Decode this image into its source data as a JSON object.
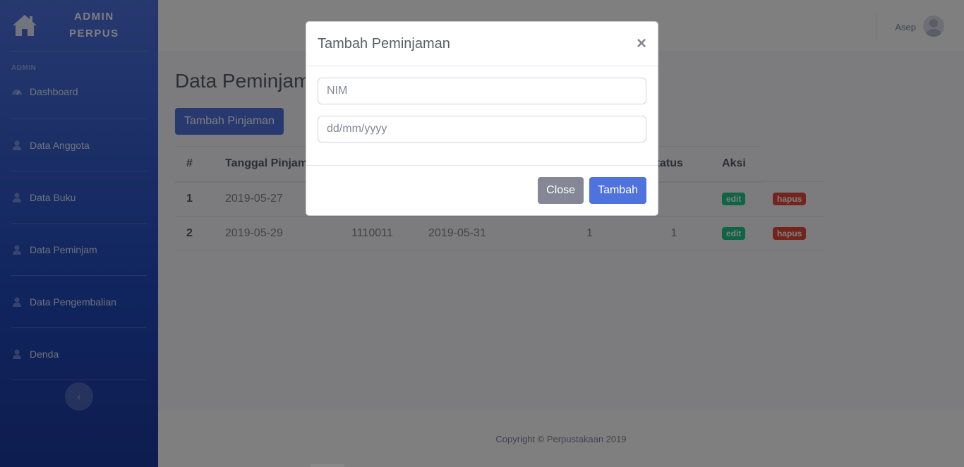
{
  "brand": {
    "line1": "ADMIN",
    "line2": "PERPUS"
  },
  "sidebar": {
    "heading": "ADMIN",
    "items": [
      {
        "label": "Dashboard",
        "icon": "tachometer-icon"
      },
      {
        "label": "Data Anggota",
        "icon": "user-icon"
      },
      {
        "label": "Data Buku",
        "icon": "user-icon"
      },
      {
        "label": "Data Peminjam",
        "icon": "user-icon"
      },
      {
        "label": "Data Pengembalian",
        "icon": "user-icon"
      },
      {
        "label": "Denda",
        "icon": "user-icon"
      }
    ],
    "toggle": "‹"
  },
  "topbar": {
    "user_name": "Asep"
  },
  "main": {
    "title": "Data Peminjaman",
    "add_button": "Tambah Pinjaman",
    "table": {
      "headers": [
        "#",
        "Tanggal Pinjam",
        "",
        "",
        "",
        "Status",
        "Aksi",
        ""
      ],
      "rows": [
        {
          "no": "1",
          "tanggal": "2019-05-27",
          "nim": "",
          "kembali": "",
          "c5": "",
          "status": "",
          "edit": "edit",
          "hapus": "hapus"
        },
        {
          "no": "2",
          "tanggal": "2019-05-29",
          "nim": "1110011",
          "kembali": "2019-05-31",
          "c5": "1",
          "status": "1",
          "edit": "edit",
          "hapus": "hapus"
        }
      ]
    }
  },
  "footer": {
    "text": "Copyright © Perpustakaan 2019"
  },
  "modal": {
    "title": "Tambah Peminjaman",
    "close_symbol": "×",
    "nim_placeholder": "NIM",
    "date_placeholder": "dd/mm/yyyy",
    "close_label": "Close",
    "submit_label": "Tambah"
  },
  "colors": {
    "primary": "#4e73df",
    "success": "#1cc88a",
    "danger": "#e74a3b",
    "secondary": "#858796"
  }
}
